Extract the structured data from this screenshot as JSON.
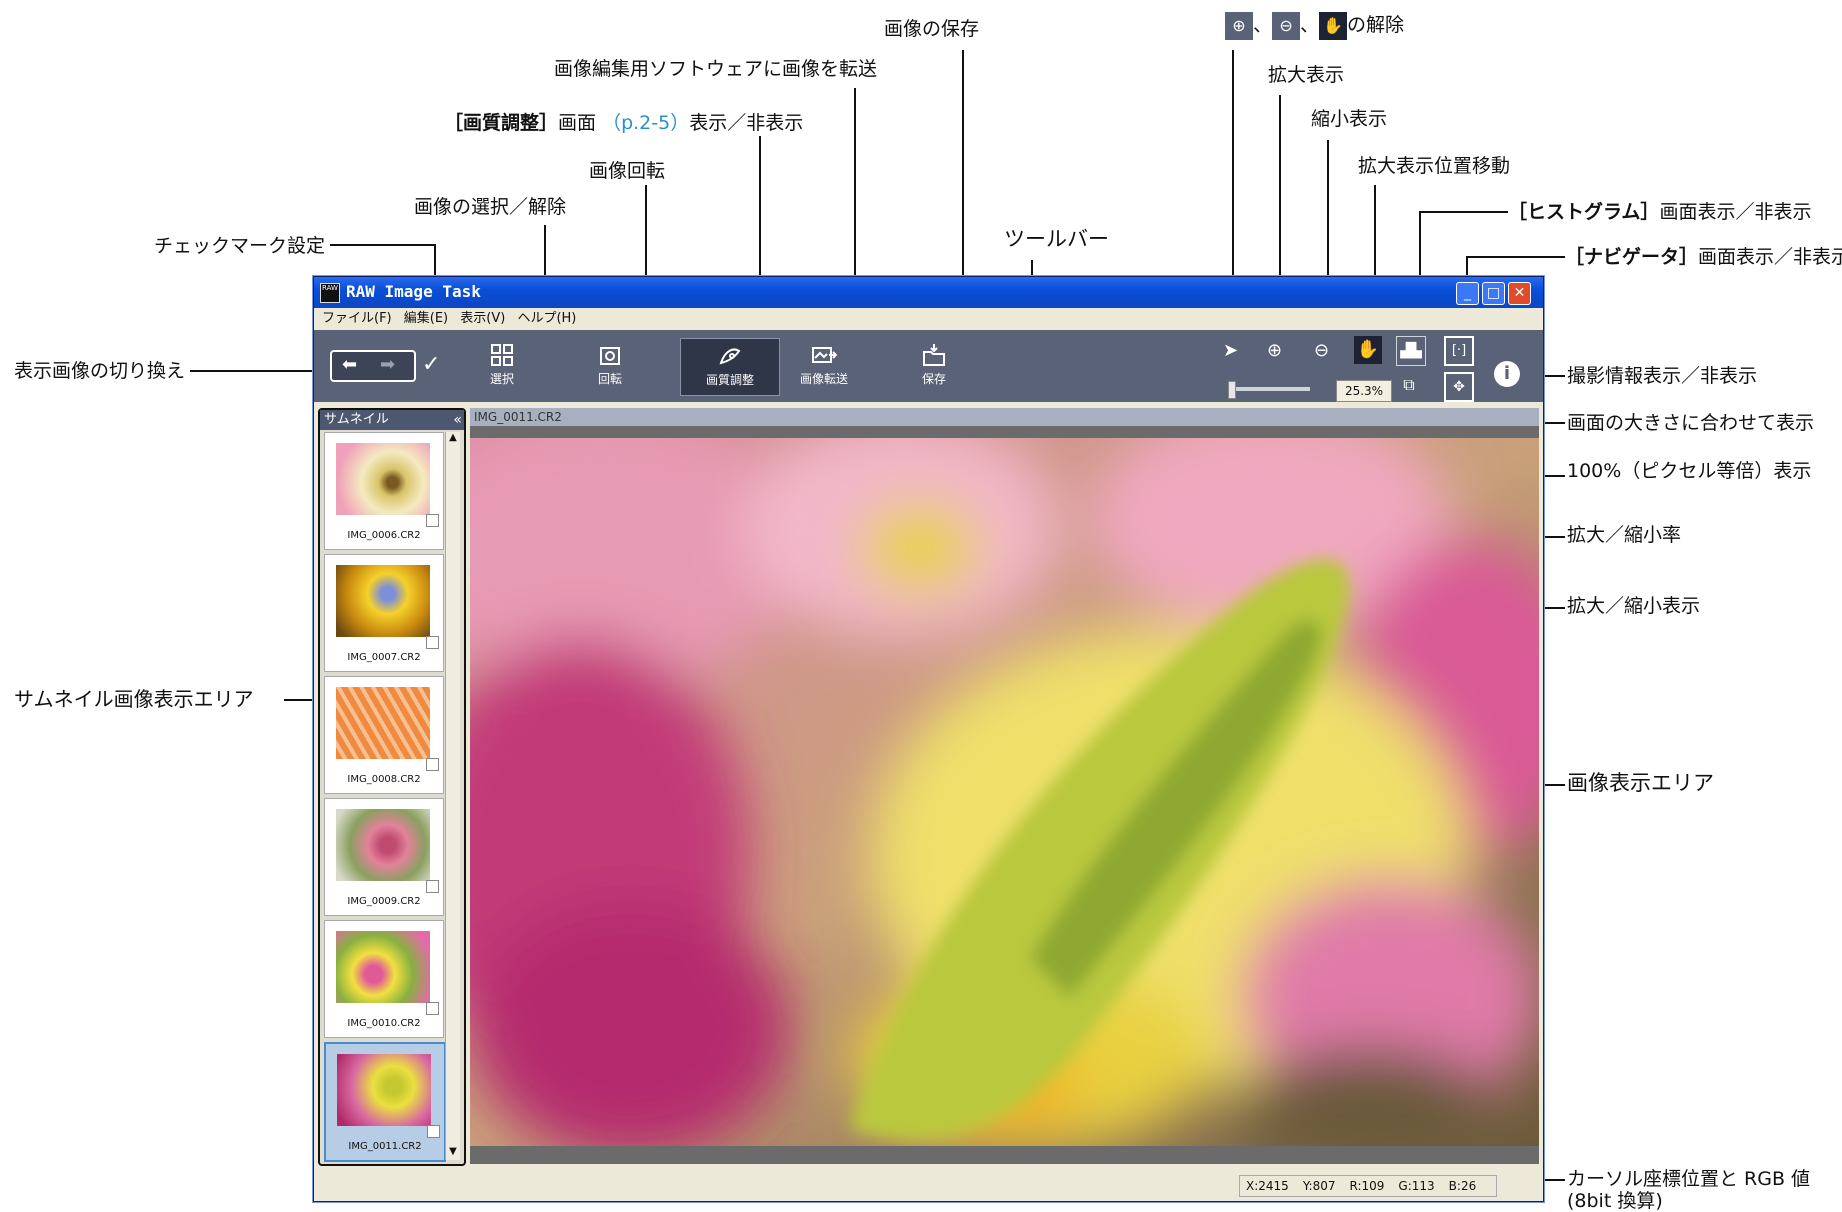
{
  "window": {
    "title": "RAW Image Task",
    "menu": [
      "ファイル(F)",
      "編集(E)",
      "表示(V)",
      "ヘルプ(H)"
    ],
    "toolbar": {
      "buttons": [
        {
          "label": "選択",
          "icon": "grid-icon"
        },
        {
          "label": "回転",
          "icon": "rotate-icon"
        },
        {
          "label": "画質調整",
          "icon": "adjust-icon",
          "active": true
        },
        {
          "label": "画像転送",
          "icon": "transfer-icon"
        },
        {
          "label": "保存",
          "icon": "save-icon"
        }
      ],
      "zoom_rate": "25.3%"
    },
    "thumbnail_panel": {
      "title": "サムネイル",
      "items": [
        {
          "caption": "IMG_0006.CR2"
        },
        {
          "caption": "IMG_0007.CR2"
        },
        {
          "caption": "IMG_0008.CR2"
        },
        {
          "caption": "IMG_0009.CR2"
        },
        {
          "caption": "IMG_0010.CR2"
        },
        {
          "caption": "IMG_0011.CR2",
          "selected": true
        }
      ]
    },
    "image_area": {
      "filename": "IMG_0011.CR2"
    },
    "status": {
      "x": "X:2415",
      "y": "Y:807",
      "r": "R:109",
      "g": "G:113",
      "b": "B:26"
    }
  },
  "annotations": {
    "save": "画像の保存",
    "transfer": "画像編集用ソフトウェアに画像を転送",
    "adjust_bracket": "［画質調整］",
    "adjust_mid": "画面",
    "adjust_link": "（p.2-5）",
    "adjust_tail": "表示／非表示",
    "rotate": "画像回転",
    "select": "画像の選択／解除",
    "checkmark": "チェックマーク設定",
    "toolbar": "ツールバー",
    "switch_image": "表示画像の切り換え",
    "thumbnail_area": "サムネイル画像表示エリア",
    "release": "の解除",
    "zoom_in": "拡大表示",
    "zoom_out": "縮小表示",
    "pan": "拡大表示位置移動",
    "histogram_bracket": "［ヒストグラム］",
    "histogram_tail": "画面表示／非表示",
    "navigator_bracket": "［ナビゲータ］",
    "navigator_tail": "画面表示／非表示",
    "shooting_info": "撮影情報表示／非表示",
    "fit": "画面の大きさに合わせて表示",
    "pixel100": "100%（ピクセル等倍）表示",
    "zoom_rate": "拡大／縮小率",
    "zoom_slider": "拡大／縮小表示",
    "image_area": "画像表示エリア",
    "cursor_line1": "カーソル座標位置と RGB 値",
    "cursor_line2": "(8bit 換算)"
  }
}
